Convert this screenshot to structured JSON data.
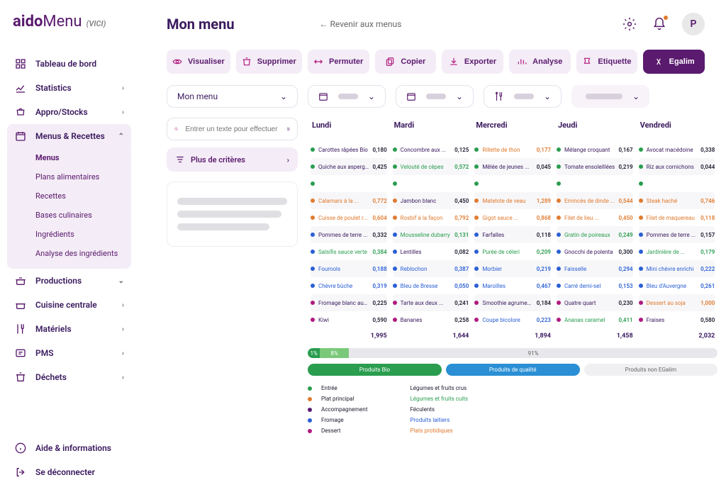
{
  "logo": {
    "bold": "aido",
    "light": "Menu",
    "tag": "(VICI)"
  },
  "nav": [
    {
      "label": "Tableau de bord",
      "icon": "dashboard",
      "chev": ""
    },
    {
      "label": "Statistics",
      "icon": "stats",
      "chev": "›"
    },
    {
      "label": "Appro/Stocks",
      "icon": "basket",
      "chev": "›"
    }
  ],
  "nav_active": {
    "label": "Menus & Recettes",
    "icon": "calendar",
    "chev": "⌃",
    "subs": [
      "Menus",
      "Plans alimentaires",
      "Recettes",
      "Bases culinaires",
      "Ingrédients",
      "Analyse des ingrédients"
    ]
  },
  "nav2": [
    {
      "label": "Productions",
      "icon": "pot",
      "chev": "⌄"
    },
    {
      "label": "Cuisine centrale",
      "icon": "pot2",
      "chev": "›"
    },
    {
      "label": "Matériels",
      "icon": "utensils",
      "chev": "›"
    },
    {
      "label": "PMS",
      "icon": "pms",
      "chev": "›"
    },
    {
      "label": "Déchets",
      "icon": "trash",
      "chev": "›"
    }
  ],
  "nav_footer": [
    {
      "label": "Aide & informations",
      "icon": "info"
    },
    {
      "label": "Se déconnecter",
      "icon": "logout"
    }
  ],
  "header": {
    "title": "Mon menu",
    "back": "←   Revenir aux menus",
    "avatar": "P"
  },
  "toolbar": [
    {
      "label": "Visualiser"
    },
    {
      "label": "Supprimer"
    },
    {
      "label": "Permuter"
    },
    {
      "label": "Copier"
    },
    {
      "label": "Exporter"
    },
    {
      "label": "Analyse"
    },
    {
      "label": "Etiquette"
    },
    {
      "label": "Egalim",
      "primary": true
    }
  ],
  "filter_menu": "Mon menu",
  "search": {
    "placeholder": "Entrer un texte pour effectuer"
  },
  "criteria": "Plus de critères",
  "days": [
    "Lundi",
    "Mardi",
    "Mercredi",
    "Jeudi",
    "Vendredi"
  ],
  "grid": [
    [
      {
        "d": "green",
        "l": "Carottes râpées Bio",
        "v": "0,180",
        "c": ""
      },
      {
        "d": "green",
        "l": "Quiche aux asperges",
        "v": "0,425",
        "c": ""
      },
      {
        "d": "green",
        "l": "",
        "v": "",
        "c": ""
      },
      {
        "d": "orange",
        "l": "Calamars à la ...",
        "v": "0,772",
        "c": "orange"
      },
      {
        "d": "orange",
        "l": "Cuisse de poulet r...",
        "v": "0,604",
        "c": "orange"
      },
      {
        "d": "blue",
        "l": "Pommes de terre ...",
        "v": "0,332",
        "c": ""
      },
      {
        "d": "blue",
        "l": "Salsifis sauce verte",
        "v": "0,384",
        "c": "green"
      },
      {
        "d": "blue",
        "l": "Fournols",
        "v": "0,188",
        "c": "blue"
      },
      {
        "d": "blue",
        "l": "Chèvre bûche",
        "v": "0,319",
        "c": "blue"
      },
      {
        "d": "magenta",
        "l": "Fromage blanc aux ...",
        "v": "0,225",
        "c": ""
      },
      {
        "d": "magenta",
        "l": "Kiwi",
        "v": "0,590",
        "c": ""
      }
    ],
    [
      {
        "d": "green",
        "l": "Concombre aux ...",
        "v": "0,125",
        "c": ""
      },
      {
        "d": "green",
        "l": "Velouté de cèpes",
        "v": "0,572",
        "c": "green"
      },
      {
        "d": "green",
        "l": "",
        "v": "",
        "c": ""
      },
      {
        "d": "orange",
        "l": "Jambon blanc",
        "v": "0,450",
        "c": ""
      },
      {
        "d": "orange",
        "l": "Rosbif à la façon",
        "v": "0,792",
        "c": "orange"
      },
      {
        "d": "blue",
        "l": "Mousseline dubarry",
        "v": "0,131",
        "c": "green"
      },
      {
        "d": "blue",
        "l": "Lentilles",
        "v": "0,082",
        "c": ""
      },
      {
        "d": "blue",
        "l": "Reblochon",
        "v": "0,387",
        "c": "blue"
      },
      {
        "d": "blue",
        "l": "Bleu de Bresse",
        "v": "0,050",
        "c": "blue"
      },
      {
        "d": "magenta",
        "l": "Tarte aux deux ...",
        "v": "0,241",
        "c": ""
      },
      {
        "d": "magenta",
        "l": "Bananes",
        "v": "0,258",
        "c": ""
      }
    ],
    [
      {
        "d": "green",
        "l": "Rillette de thon",
        "v": "0,177",
        "c": "orange"
      },
      {
        "d": "green",
        "l": "Mêlée de jeunes ...",
        "v": "0,045",
        "c": ""
      },
      {
        "d": "green",
        "l": "",
        "v": "",
        "c": ""
      },
      {
        "d": "orange",
        "l": "Matelote de veau",
        "v": "1,289",
        "c": "orange"
      },
      {
        "d": "orange",
        "l": "Gigot sauce ...",
        "v": "0,868",
        "c": "orange"
      },
      {
        "d": "blue",
        "l": "Farfalles",
        "v": "0,118",
        "c": ""
      },
      {
        "d": "blue",
        "l": "Purée de céleri",
        "v": "0,209",
        "c": "green"
      },
      {
        "d": "blue",
        "l": "Morbier",
        "v": "0,219",
        "c": "blue"
      },
      {
        "d": "blue",
        "l": "Maroilles",
        "v": "0,467",
        "c": "blue"
      },
      {
        "d": "magenta",
        "l": "Smoothie agrumes ...",
        "v": "0,184",
        "c": ""
      },
      {
        "d": "magenta",
        "l": "Coupe bicolore",
        "v": "0,223",
        "c": "blue"
      }
    ],
    [
      {
        "d": "green",
        "l": "Mélange croquant",
        "v": "0,167",
        "c": ""
      },
      {
        "d": "green",
        "l": "Tomate ensoleillées",
        "v": "0,219",
        "c": ""
      },
      {
        "d": "green",
        "l": "",
        "v": "",
        "c": ""
      },
      {
        "d": "orange",
        "l": "Emincés de dinde ...",
        "v": "0,544",
        "c": "orange"
      },
      {
        "d": "orange",
        "l": "Filet de lieu ...",
        "v": "0,450",
        "c": "orange"
      },
      {
        "d": "blue",
        "l": "Gratin de poireaux",
        "v": "0,249",
        "c": "green"
      },
      {
        "d": "blue",
        "l": "Gnocchi de polenta",
        "v": "0,300",
        "c": ""
      },
      {
        "d": "blue",
        "l": "Faisselle",
        "v": "0,294",
        "c": "blue"
      },
      {
        "d": "blue",
        "l": "Carré demi-sel",
        "v": "0,153",
        "c": "blue"
      },
      {
        "d": "magenta",
        "l": "Quatre quart",
        "v": "0,230",
        "c": ""
      },
      {
        "d": "magenta",
        "l": "Ananas caramel",
        "v": "0,411",
        "c": "green"
      }
    ],
    [
      {
        "d": "green",
        "l": "Avocat macédoine",
        "v": "0,338",
        "c": ""
      },
      {
        "d": "green",
        "l": "Riz aux cornichons",
        "v": "0,044",
        "c": ""
      },
      {
        "d": "green",
        "l": "",
        "v": "",
        "c": ""
      },
      {
        "d": "orange",
        "l": "Steak haché",
        "v": "0,746",
        "c": "orange"
      },
      {
        "d": "orange",
        "l": "Filet de maquereau",
        "v": "0,118",
        "c": "orange"
      },
      {
        "d": "blue",
        "l": "Pommes de terre ...",
        "v": "0,157",
        "c": ""
      },
      {
        "d": "blue",
        "l": "Jardinière de ...",
        "v": "0,179",
        "c": "green"
      },
      {
        "d": "blue",
        "l": "Mini chèvre enrichi",
        "v": "0,222",
        "c": "blue"
      },
      {
        "d": "blue",
        "l": "Bleu d'Auvergne",
        "v": "0,261",
        "c": "blue"
      },
      {
        "d": "magenta",
        "l": "Dessert au soja",
        "v": "1,000",
        "c": "orange"
      },
      {
        "d": "magenta",
        "l": "Fraises",
        "v": "0,580",
        "c": ""
      }
    ]
  ],
  "totals": [
    "1,995",
    "1,644",
    "1,894",
    "1,458",
    "2,032"
  ],
  "progress": {
    "p1": "1%",
    "p2": "8%",
    "p3": "91%"
  },
  "categories": [
    "Produits Bio",
    "Produits de qualité",
    "Produits non EGalim"
  ],
  "legend1": [
    {
      "d": "green",
      "l": "Entrée"
    },
    {
      "d": "orange",
      "l": "Plat principal"
    },
    {
      "d": "purple",
      "l": "Accompagnement"
    },
    {
      "d": "blue",
      "l": "Fromage"
    },
    {
      "d": "magenta",
      "l": "Dessert"
    }
  ],
  "legend2": [
    {
      "l": "Légumes et fruits crus",
      "c": ""
    },
    {
      "l": "Légumes et fruits cuits",
      "c": "green"
    },
    {
      "l": "Féculents",
      "c": ""
    },
    {
      "l": "Produits laitiers",
      "c": "blue"
    },
    {
      "l": "Plats protidiques",
      "c": "orange"
    }
  ]
}
